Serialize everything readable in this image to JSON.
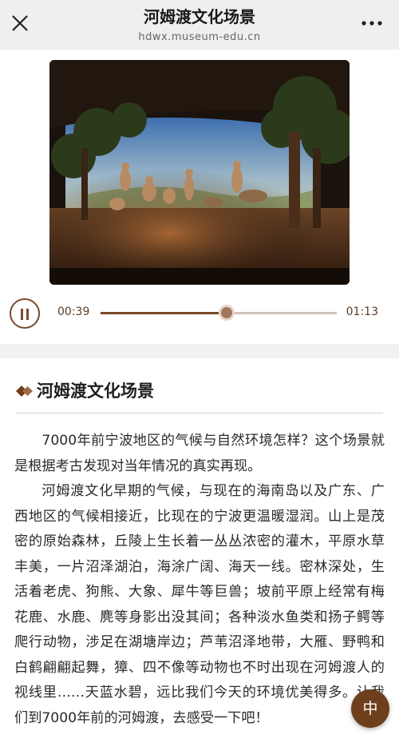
{
  "header": {
    "title": "河姆渡文化场景",
    "url": "hdwx.museum-edu.cn",
    "close_icon": "close-icon",
    "more_icon": "more-dots-icon"
  },
  "player": {
    "current_time": "00:39",
    "total_time": "01:13",
    "progress": 0.534,
    "state": "playing",
    "button_icon": "pause-icon"
  },
  "article": {
    "title": "河姆渡文化场景",
    "paragraphs": [
      "7000年前宁波地区的气候与自然环境怎样？这个场景就是根据考古发现对当年情况的真实再现。",
      "河姆渡文化早期的气候，与现在的海南岛以及广东、广西地区的气候相接近，比现在的宁波更温暖湿润。山上是茂密的原始森林，丘陵上生长着一丛丛浓密的灌木，平原水草丰美，一片沼泽湖泊，海涂广阔、海天一线。密林深处，生活着老虎、狗熊、大象、犀牛等巨兽；坡前平原上经常有梅花鹿、水鹿、麂等身影出没其间；各种淡水鱼类和扬子鳄等爬行动物，涉足在湖塘岸边；芦苇沼泽地带，大雁、野鸭和白鹤翩翩起舞，獐、四不像等动物也不时出现在河姆渡人的视线里……天蓝水碧，远比我们今天的环境优美得多。让我们到7000年前的河姆渡，去感受一下吧！"
    ]
  },
  "language_button": {
    "label": "中"
  },
  "colors": {
    "accent": "#7a4a2a",
    "lang_button": "#6e3f1c"
  }
}
